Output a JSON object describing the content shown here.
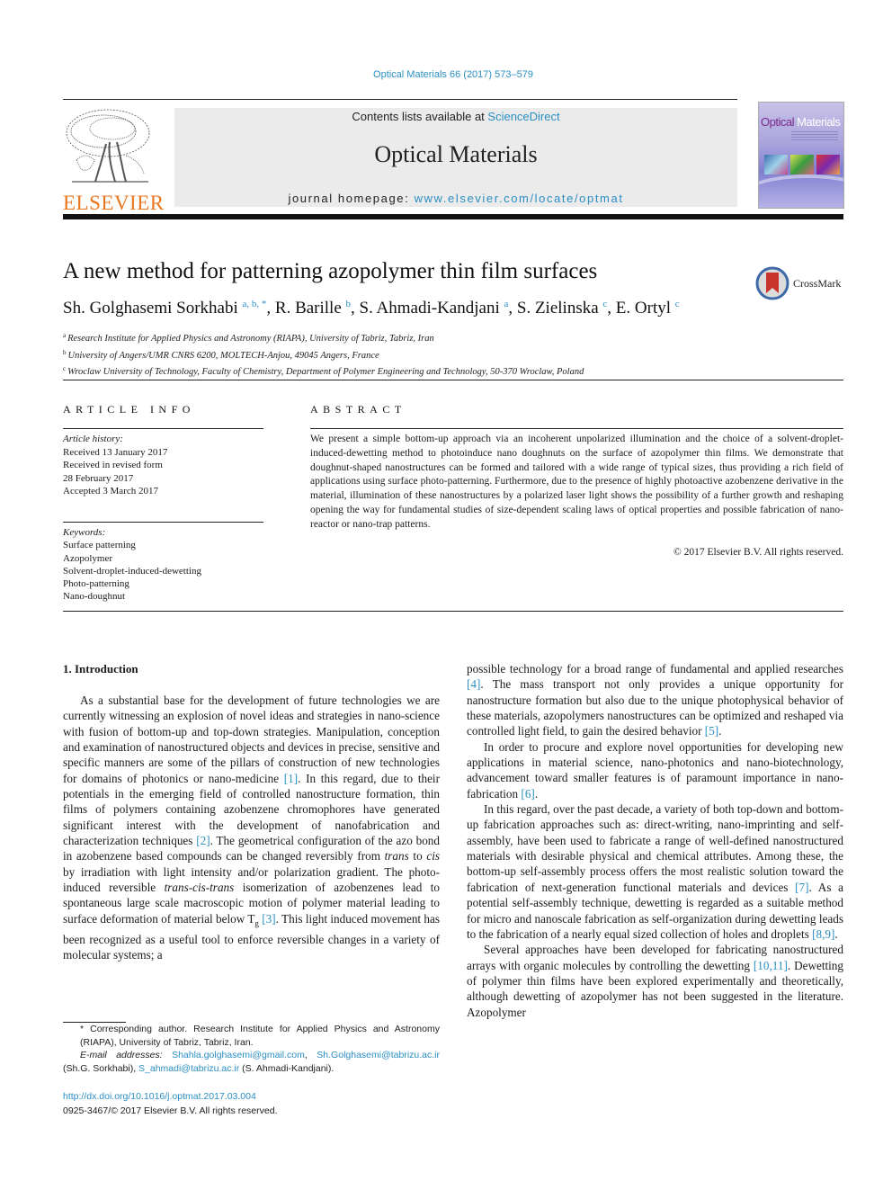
{
  "header": {
    "citation": "Optical Materials 66 (2017) 573–579",
    "publisher_logo_text": "ELSEVIER",
    "contents_prefix": "Contents lists available at ",
    "contents_link": "ScienceDirect",
    "journal_title": "Optical Materials",
    "homepage_prefix": "journal homepage: ",
    "homepage_link": "www.elsevier.com/locate/optmat",
    "cover_title_part1": "Optical",
    "cover_title_part2": "Materials",
    "colors": {
      "link": "#2b8fc4",
      "elsevier_orange": "#e87722",
      "banner_bg": "#ebebeb"
    }
  },
  "article": {
    "title": "A new method for patterning azopolymer thin film surfaces",
    "crossmark_label": "CrossMark",
    "authors": [
      {
        "name": "Sh. Golghasemi Sorkhabi",
        "sup": "a, b, *"
      },
      {
        "name": "R. Barille",
        "sup": "b"
      },
      {
        "name": "S. Ahmadi-Kandjani",
        "sup": "a"
      },
      {
        "name": "S. Zielinska",
        "sup": "c"
      },
      {
        "name": "E. Ortyl",
        "sup": "c"
      }
    ],
    "affiliations": [
      {
        "key": "a",
        "text": "Research Institute for Applied Physics and Astronomy (RIAPA), University of Tabriz, Tabriz, Iran"
      },
      {
        "key": "b",
        "text": "University of Angers/UMR CNRS 6200, MOLTECH-Anjou, 49045 Angers, France"
      },
      {
        "key": "c",
        "text": "Wroclaw University of Technology, Faculty of Chemistry, Department of Polymer Engineering and Technology, 50-370 Wroclaw, Poland"
      }
    ]
  },
  "article_info": {
    "heading": "ARTICLE INFO",
    "history_label": "Article history:",
    "history": [
      "Received 13 January 2017",
      "Received in revised form",
      "28 February 2017",
      "Accepted 3 March 2017"
    ],
    "keywords_label": "Keywords:",
    "keywords": [
      "Surface patterning",
      "Azopolymer",
      "Solvent-droplet-induced-dewetting",
      "Photo-patterning",
      "Nano-doughnut"
    ]
  },
  "abstract": {
    "heading": "ABSTRACT",
    "text": "We present a simple bottom-up approach via an incoherent unpolarized illumination and the choice of a solvent-droplet-induced-dewetting method to photoinduce nano doughnuts on the surface of azopolymer thin films. We demonstrate that doughnut-shaped nanostructures can be formed and tailored with a wide range of typical sizes, thus providing a rich field of applications using surface photo-patterning. Furthermore, due to the presence of highly photoactive azobenzene derivative in the material, illumination of these nanostructures by a polarized laser light shows the possibility of a further growth and reshaping opening the way for fundamental studies of size-dependent scaling laws of optical properties and possible fabrication of nano-reactor or nano-trap patterns.",
    "copyright": "© 2017 Elsevier B.V. All rights reserved."
  },
  "body": {
    "section_heading": "1.  Introduction",
    "col1": {
      "p1_a": "As a substantial base for the development of future technologies we are currently witnessing an explosion of novel ideas and strategies in nano-science with fusion of bottom-up and top-down strategies. Manipulation, conception and examination of nanostructured objects and devices in precise, sensitive and specific manners are some of the pillars of construction of new technologies for domains of photonics or nano-medicine ",
      "ref1": "[1]",
      "p1_b": ". In this regard, due to their potentials in the emerging field of controlled nanostructure formation, thin films of polymers containing azobenzene chromophores have generated significant interest with the development of nanofabrication and characterization techniques ",
      "ref2": "[2]",
      "p1_c": ". The geometrical configuration of the azo bond in azobenzene based compounds can be changed reversibly from ",
      "it_trans": "trans",
      "p1_d": " to ",
      "it_cis": "cis",
      "p1_e": " by irradiation with light intensity and/or polarization gradient. The photo-induced reversible ",
      "it_tct": "trans-cis-trans",
      "p1_f": " isomerization of azobenzenes lead to spontaneous large scale macroscopic motion of polymer material leading to surface deformation of material below T",
      "sub_g": "g",
      "p1_g": " ",
      "ref3": "[3]",
      "p1_h": ". This light induced movement has been recognized as a useful tool to enforce reversible changes in a variety of molecular systems; a"
    },
    "col2": {
      "p1_a": "possible technology for a broad range of fundamental and applied researches ",
      "ref4": "[4]",
      "p1_b": ". The mass transport not only provides a unique opportunity for nanostructure formation but also due to the unique photophysical behavior of these materials, azopolymers nanostructures can be optimized and reshaped via controlled light field, to gain the desired behavior ",
      "ref5": "[5]",
      "p1_c": ".",
      "p2_a": "In order to procure and explore novel opportunities for developing new applications in material science, nano-photonics and nano-biotechnology, advancement toward smaller features is of paramount importance in nano-fabrication ",
      "ref6": "[6]",
      "p2_b": ".",
      "p3_a": "In this regard, over the past decade, a variety of both top-down and bottom-up fabrication approaches such as: direct-writing, nano-imprinting and self-assembly, have been used to fabricate a range of well-defined nanostructured materials with desirable physical and chemical attributes. Among these, the bottom-up self-assembly process offers the most realistic solution toward the fabrication of next-generation functional materials and devices ",
      "ref7": "[7]",
      "p3_b": ". As a potential self-assembly technique, dewetting is regarded as a suitable method for micro and nanoscale fabrication as self-organization during dewetting leads to the fabrication of a nearly equal sized collection of holes and droplets ",
      "ref89": "[8,9]",
      "p3_c": ".",
      "p4_a": "Several approaches have been developed for fabricating nanostructured arrays with organic molecules by controlling the dewetting ",
      "ref1011": "[10,11]",
      "p4_b": ". Dewetting of polymer thin films have been explored experimentally and theoretically, although dewetting of azopolymer has not been suggested in the literature. Azopolymer"
    }
  },
  "footnote": {
    "corresponding": "* Corresponding author. Research Institute for Applied Physics and Astronomy (RIAPA), University of Tabriz, Tabriz, Iran.",
    "email_label": "E-mail addresses:",
    "email1": "Shahla.golghasemi@gmail.com",
    "sep": ", ",
    "email2": "Sh.Golghasemi@tabrizu.ac.ir",
    "owner1": " (Sh.G. Sorkhabi), ",
    "email3": "S_ahmadi@tabrizu.ac.ir",
    "owner2": " (S. Ahmadi-Kandjani).",
    "doi": "http://dx.doi.org/10.1016/j.optmat.2017.03.004",
    "issn_copyright": "0925-3467/© 2017 Elsevier B.V. All rights reserved."
  }
}
